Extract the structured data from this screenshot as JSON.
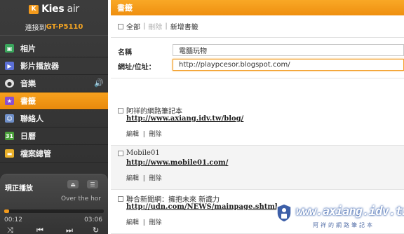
{
  "app": {
    "logo_letter": "K",
    "brand_main": "Kies",
    "brand_sub": " air"
  },
  "connection": {
    "prefix": "連接到",
    "device": "GT-P5110"
  },
  "sidebar": {
    "items": [
      {
        "label": "相片",
        "icon": "photo-icon",
        "color": "#3aa55c"
      },
      {
        "label": "影片播放器",
        "icon": "video-icon",
        "color": "#5b6fd6"
      },
      {
        "label": "音樂",
        "icon": "music-icon",
        "color": "#e0e0e0"
      },
      {
        "label": "書籤",
        "icon": "bookmark-icon",
        "color": "#8a4fd0"
      },
      {
        "label": "聯絡人",
        "icon": "contacts-icon",
        "color": "#6f8fc9"
      },
      {
        "label": "日曆",
        "icon": "calendar-icon",
        "color": "#4aa03a"
      },
      {
        "label": "檔案總管",
        "icon": "folder-icon",
        "color": "#e9b02a"
      }
    ],
    "active_index": 3
  },
  "player": {
    "title": "現正播放",
    "song": "Over the hor",
    "elapsed": "00:12",
    "total": "03:06",
    "progress": 0.05
  },
  "main": {
    "header": "書籤",
    "toolbar": {
      "select_all": "全部",
      "delete": "刪除",
      "add": "新增書籤"
    },
    "form": {
      "name_label": "名稱",
      "name_value": "電腦玩物",
      "url_label": "網址/位址：",
      "url_value": "http://playpcesor.blogspot.com/"
    },
    "bookmarks": [
      {
        "name": "阿祥的網路筆記本",
        "url": "http://www.axiang.idv.tw/blog/",
        "edit": "編輯",
        "delete": "刪除"
      },
      {
        "name": "Mobile01",
        "url": "http://www.mobile01.com/",
        "edit": "編輯",
        "delete": "刪除"
      },
      {
        "name": "聯合新聞網：擁抱未來 新識力",
        "url": "http://udn.com/NEWS/mainpage.shtml",
        "edit": "編輯",
        "delete": "刪除"
      }
    ]
  },
  "watermark": {
    "text": "www.axiang.idv.tw",
    "sub": "阿祥的網路筆記本"
  }
}
